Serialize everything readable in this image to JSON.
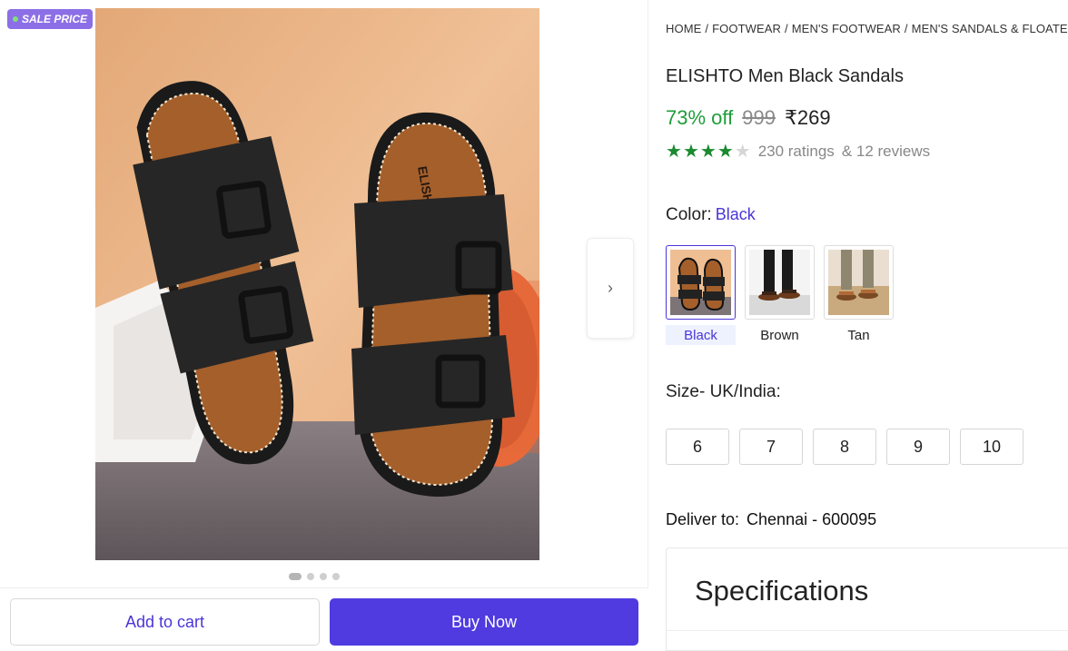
{
  "badge": {
    "label": "SALE PRICE"
  },
  "gallery": {
    "image_alt": "ELISHTO black sandals product photo",
    "next_icon": "chevron-right-icon",
    "dots_count": 4,
    "active_dot": 0
  },
  "actions": {
    "add_to_cart": "Add to cart",
    "buy_now": "Buy Now"
  },
  "breadcrumb": [
    "HOME",
    "FOOTWEAR",
    "MEN'S FOOTWEAR",
    "MEN'S SANDALS & FLOATERS"
  ],
  "product": {
    "title": "ELISHTO Men Black Sandals",
    "discount": "73% off",
    "mrp": "999",
    "price": "₹269",
    "rating_stars": 4,
    "ratings": "230 ratings",
    "reviews": "& 12 reviews"
  },
  "color": {
    "label": "Color:",
    "selected": "Black",
    "options": [
      {
        "label": "Black"
      },
      {
        "label": "Brown"
      },
      {
        "label": "Tan"
      }
    ]
  },
  "size": {
    "label": "Size- UK/India:",
    "options": [
      "6",
      "7",
      "8",
      "9",
      "10"
    ]
  },
  "delivery": {
    "label": "Deliver to:",
    "location": "Chennai - 600095"
  },
  "specifications": {
    "title": "Specifications"
  },
  "colors": {
    "accent": "#4f3be0",
    "discount": "#1f9d3a",
    "star": "#1a8a2f",
    "badge": "#8c6fe6"
  }
}
